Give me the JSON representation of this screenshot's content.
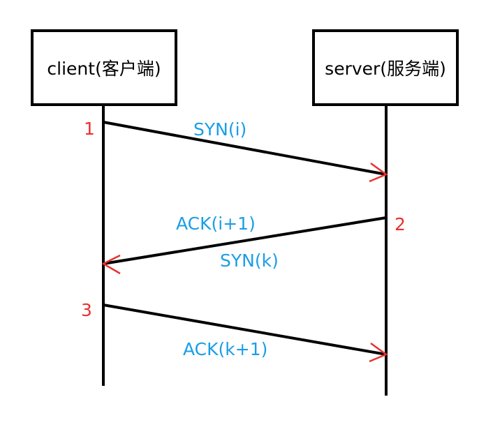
{
  "participants": {
    "client": "client(客户端)",
    "server": "server(服务端)"
  },
  "steps": [
    {
      "number": "1",
      "messages": [
        "SYN(i)"
      ]
    },
    {
      "number": "2",
      "messages": [
        "ACK(i+1)",
        "SYN(k)"
      ]
    },
    {
      "number": "3",
      "messages": [
        "ACK(k+1)"
      ]
    }
  ],
  "colors": {
    "line": "#000000",
    "arrowhead": "#e8312f",
    "message": "#1a9ee6",
    "step_number": "#e8312f"
  }
}
